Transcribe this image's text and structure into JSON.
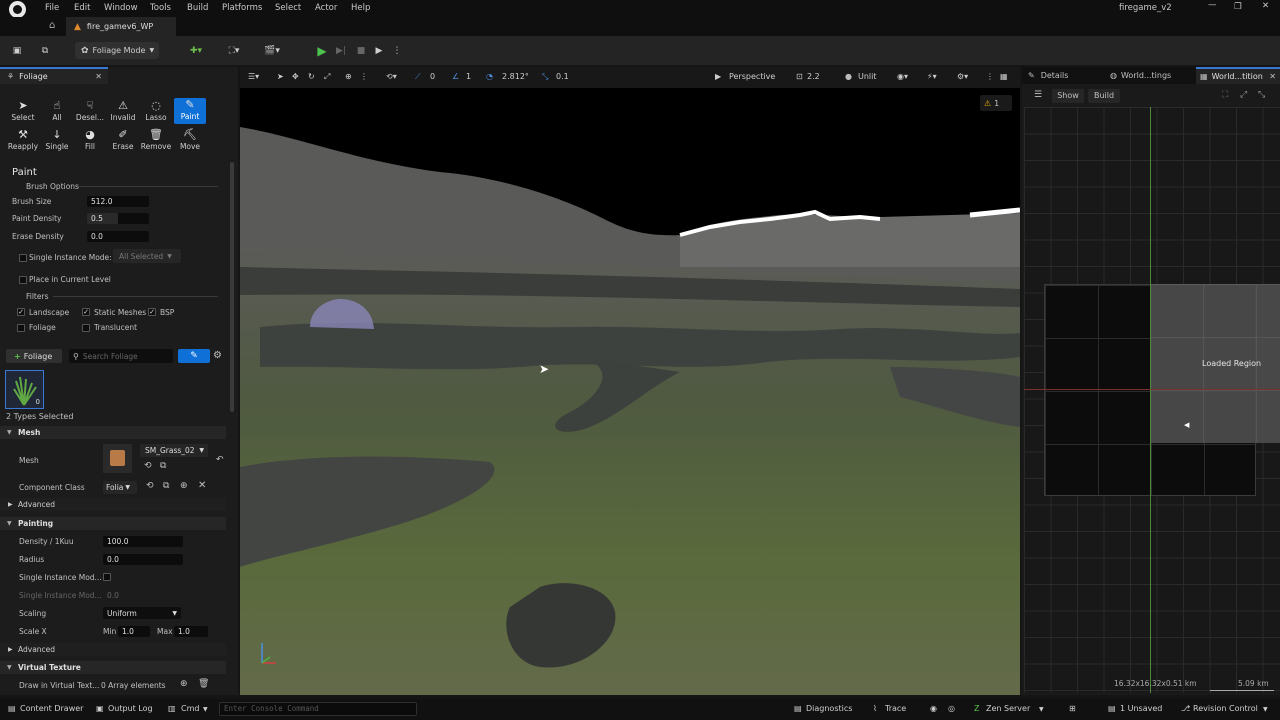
{
  "menu": [
    "File",
    "Edit",
    "Window",
    "Tools",
    "Build",
    "Platforms",
    "Select",
    "Actor",
    "Help"
  ],
  "project_name": "firegame_v2",
  "level_tab": "fire_gamev6_WP",
  "toolbar": {
    "mode_label": "Foliage Mode"
  },
  "panel": {
    "tab_label": "Foliage",
    "tools_row1": [
      "Select",
      "All",
      "Desel...",
      "Invalid",
      "Lasso",
      "Paint"
    ],
    "tools_row2": [
      "Reapply",
      "Single",
      "Fill",
      "Erase",
      "Remove",
      "Move"
    ],
    "section_title": "Paint",
    "brush_options": "Brush Options",
    "brush_size_label": "Brush Size",
    "brush_size": "512.0",
    "paint_density_label": "Paint Density",
    "paint_density": "0.5",
    "erase_density_label": "Erase Density",
    "erase_density": "0.0",
    "single_instance_label": "Single Instance Mode:",
    "single_instance_value": "All Selected",
    "place_current_label": "Place in Current Level",
    "filters_label": "Filters",
    "filter_landscape": "Landscape",
    "filter_static": "Static Meshes",
    "filter_bsp": "BSP",
    "filter_foliage": "Foliage",
    "filter_translucent": "Translucent",
    "add_foliage": "Foliage",
    "search_placeholder": "Search Foliage",
    "thumb_count": "0",
    "types_selected": "2 Types Selected",
    "mesh_section": "Mesh",
    "mesh_label": "Mesh",
    "mesh_value": "SM_Grass_02",
    "component_class_label": "Component Class",
    "component_class_value": "Folia",
    "advanced": "Advanced",
    "painting_section": "Painting",
    "density_label": "Density / 1Kuu",
    "density_value": "100.0",
    "radius_label": "Radius",
    "radius_value": "0.0",
    "single_mod1": "Single Instance Mod...",
    "single_mod2": "Single Instance Mod...",
    "single_mod2_value": "0.0",
    "scaling_label": "Scaling",
    "scaling_value": "Uniform",
    "scalex_label": "Scale X",
    "min_label": "Min",
    "min_value": "1.0",
    "max_label": "Max",
    "max_value": "1.0",
    "advanced2": "Advanced",
    "virtual_texture_section": "Virtual Texture",
    "draw_vt_label": "Draw in Virtual Text...",
    "draw_vt_value": "0 Array elements"
  },
  "viewport": {
    "grid_snap": "0",
    "rot_snap": "1",
    "cam_speed": "2.812°",
    "scale_snap": "0.1",
    "perspective": "Perspective",
    "fov": "2.2",
    "lit_mode": "Unlit",
    "warnings": "1"
  },
  "right": {
    "tabs": [
      "Details",
      "World...tings",
      "World...tition"
    ],
    "show_btn": "Show",
    "build_btn": "Build",
    "loaded_region": "Loaded Region",
    "footer_size": "16.32x16.32x0.51 km",
    "scale_label": "5.09 km"
  },
  "status": {
    "content_drawer": "Content Drawer",
    "output_log": "Output Log",
    "cmd": "Cmd",
    "console_placeholder": "Enter Console Command",
    "diagnostics": "Diagnostics",
    "trace": "Trace",
    "zen_server": "Zen Server",
    "unsaved": "1 Unsaved",
    "revision_control": "Revision Control"
  }
}
